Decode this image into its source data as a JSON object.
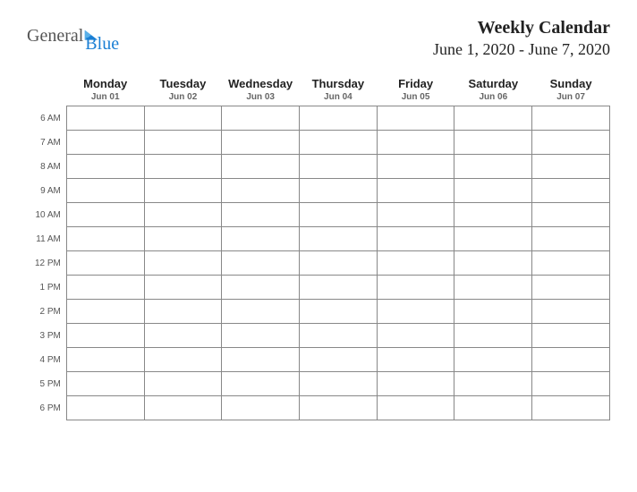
{
  "logo": {
    "text_general": "General",
    "text_blue": "Blue"
  },
  "title": "Weekly Calendar",
  "date_range": "June 1, 2020 - June 7, 2020",
  "days": [
    {
      "name": "Monday",
      "date": "Jun 01"
    },
    {
      "name": "Tuesday",
      "date": "Jun 02"
    },
    {
      "name": "Wednesday",
      "date": "Jun 03"
    },
    {
      "name": "Thursday",
      "date": "Jun 04"
    },
    {
      "name": "Friday",
      "date": "Jun 05"
    },
    {
      "name": "Saturday",
      "date": "Jun 06"
    },
    {
      "name": "Sunday",
      "date": "Jun 07"
    }
  ],
  "hours": [
    "6 AM",
    "7 AM",
    "8 AM",
    "9 AM",
    "10 AM",
    "11 AM",
    "12 PM",
    "1 PM",
    "2 PM",
    "3 PM",
    "4 PM",
    "5 PM",
    "6 PM"
  ]
}
